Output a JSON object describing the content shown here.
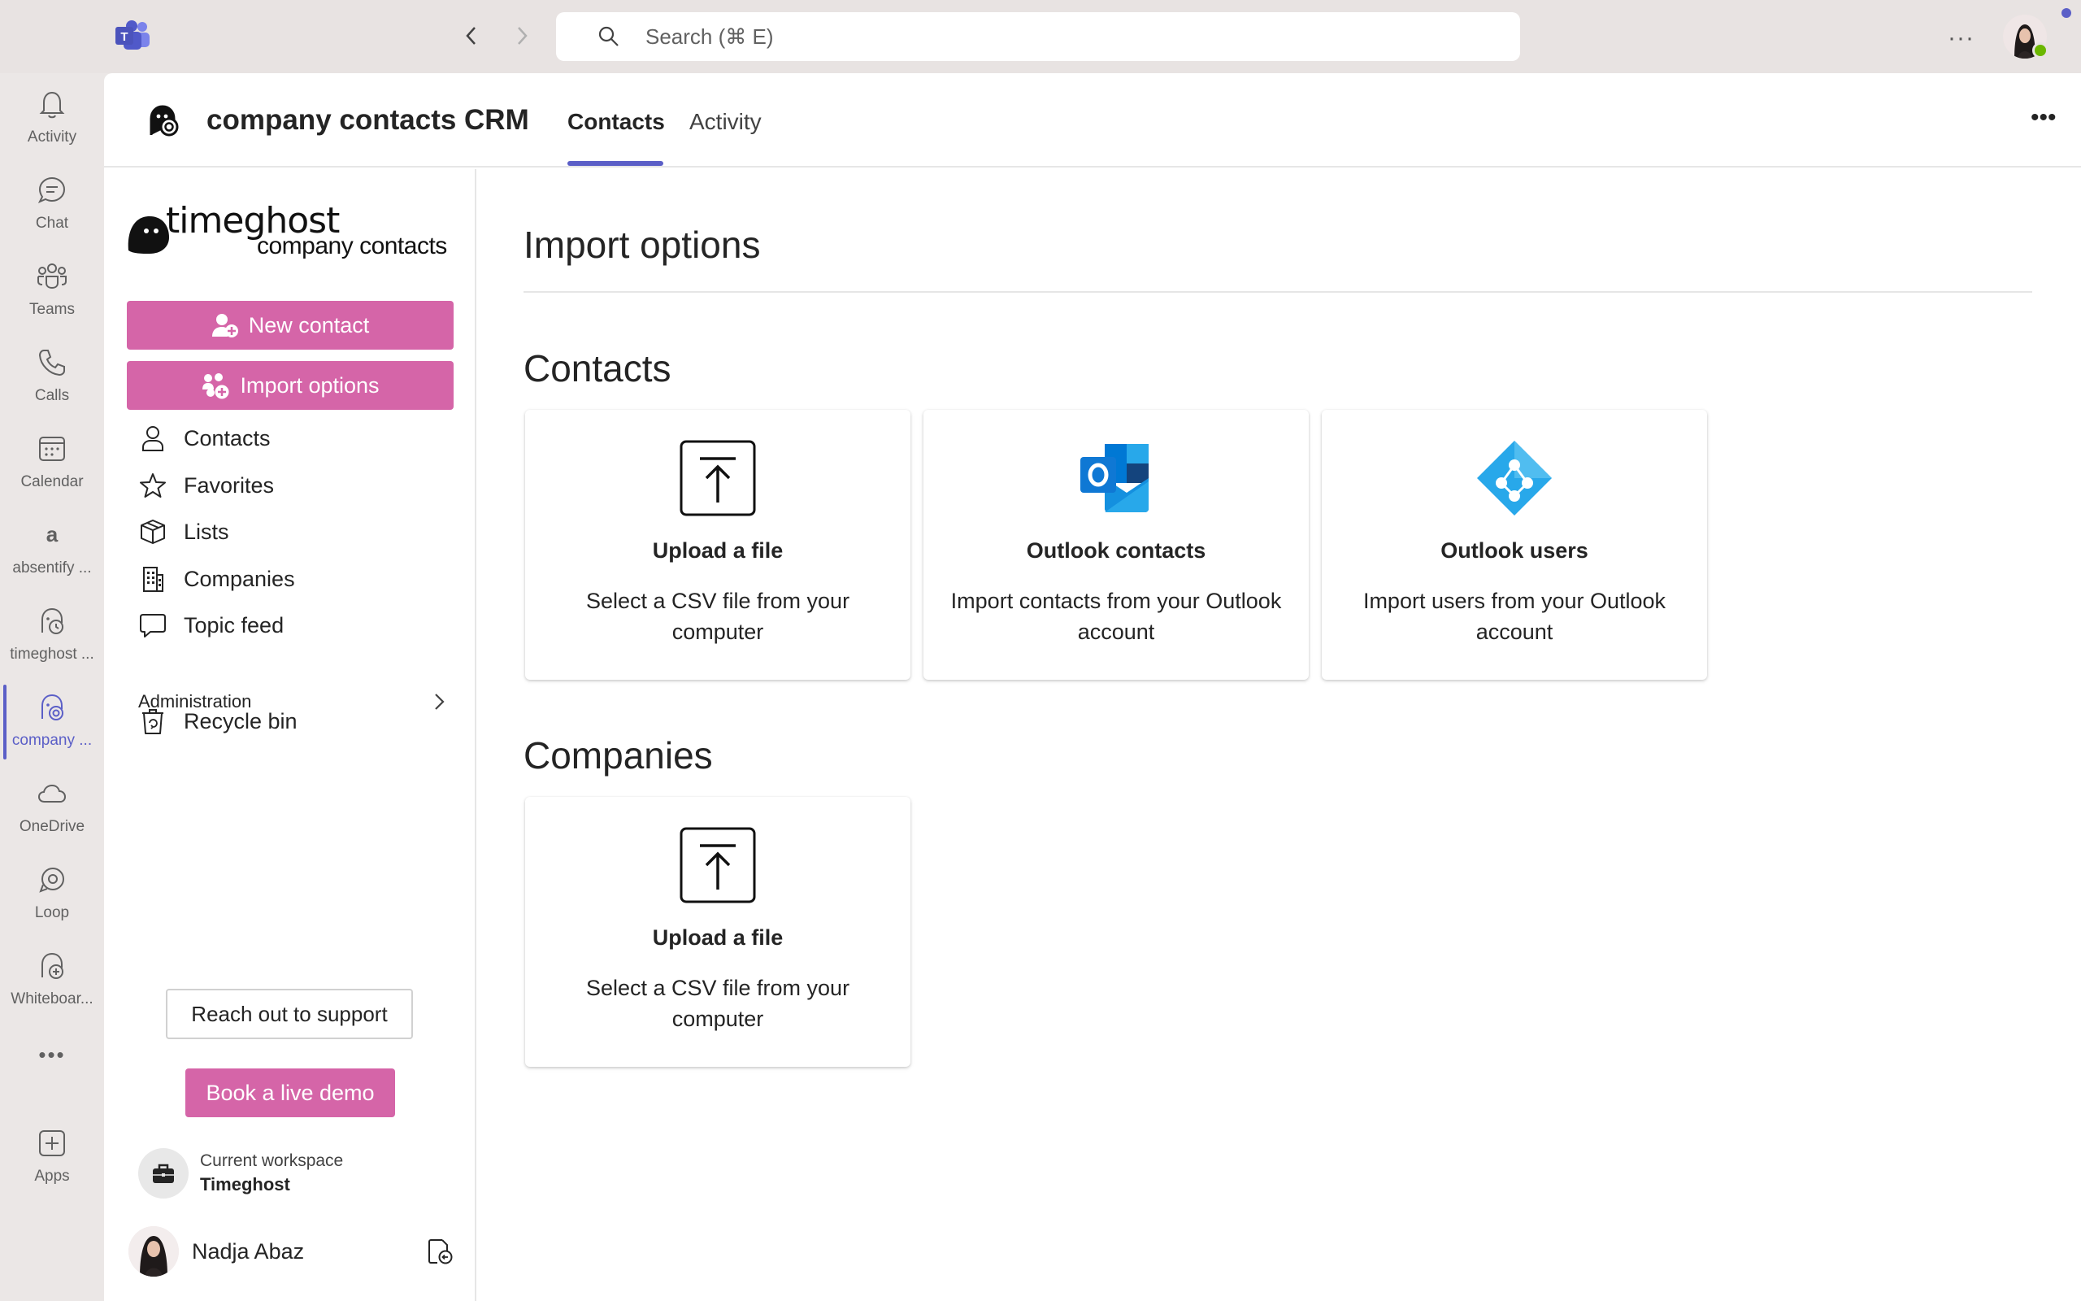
{
  "titlebar": {
    "search_placeholder": "Search (⌘ E)",
    "more": "···"
  },
  "rail": {
    "items": [
      {
        "label": "Activity",
        "icon": "bell-icon"
      },
      {
        "label": "Chat",
        "icon": "chat-icon"
      },
      {
        "label": "Teams",
        "icon": "teams-icon"
      },
      {
        "label": "Calls",
        "icon": "phone-icon"
      },
      {
        "label": "Calendar",
        "icon": "calendar-icon"
      },
      {
        "label": "absentify ...",
        "icon": "absentify-icon"
      },
      {
        "label": "timeghost ...",
        "icon": "timeghost-icon"
      },
      {
        "label": "company ...",
        "icon": "company-contacts-icon",
        "active": true
      },
      {
        "label": "OneDrive",
        "icon": "cloud-icon"
      },
      {
        "label": "Loop",
        "icon": "loop-icon"
      },
      {
        "label": "Whiteboar...",
        "icon": "whiteboard-icon"
      }
    ],
    "more": "•••",
    "apps_label": "Apps"
  },
  "header": {
    "app_title": "company contacts CRM",
    "tabs": [
      {
        "label": "Contacts",
        "active": true
      },
      {
        "label": "Activity",
        "active": false
      }
    ],
    "more": "•••"
  },
  "leftnav": {
    "brand_name": "timeghost",
    "brand_sub": "company contacts",
    "new_contact": "New contact",
    "import_options": "Import options",
    "items": [
      {
        "label": "Contacts",
        "icon": "person-icon"
      },
      {
        "label": "Favorites",
        "icon": "star-icon"
      },
      {
        "label": "Lists",
        "icon": "box-icon"
      },
      {
        "label": "Companies",
        "icon": "building-icon"
      },
      {
        "label": "Topic feed",
        "icon": "comment-icon"
      }
    ],
    "administration": "Administration",
    "recycle_bin": "Recycle bin",
    "support": "Reach out to support",
    "demo": "Book a live demo",
    "workspace_label": "Current workspace",
    "workspace_name": "Timeghost",
    "user_name": "Nadja Abaz"
  },
  "content": {
    "page_title": "Import options",
    "contacts_section": "Contacts",
    "companies_section": "Companies",
    "contact_cards": [
      {
        "title": "Upload a file",
        "desc": "Select a CSV file from your computer",
        "icon": "upload-icon"
      },
      {
        "title": "Outlook contacts",
        "desc": "Import contacts from your Outlook account",
        "icon": "outlook-icon"
      },
      {
        "title": "Outlook users",
        "desc": "Import users from your Outlook account",
        "icon": "outlook-users-icon"
      }
    ],
    "company_cards": [
      {
        "title": "Upload a file",
        "desc": "Select a CSV file from your computer",
        "icon": "upload-icon"
      }
    ]
  },
  "colors": {
    "accent": "#5b5fc7",
    "pink": "#d565a8",
    "presence": "#6bb700"
  }
}
